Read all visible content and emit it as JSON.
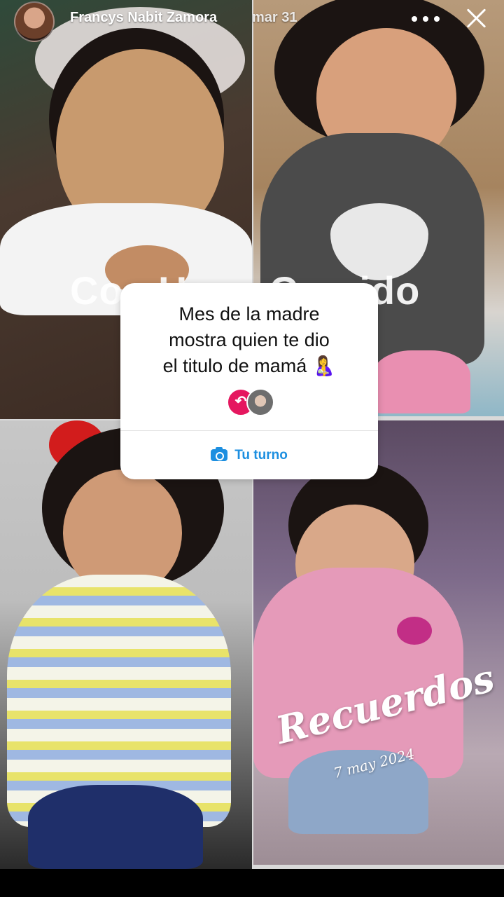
{
  "header": {
    "username": "Francys Nabit Zamora",
    "timestamp": "mar 31",
    "more_icon": "more-horizontal-icon",
    "close_icon": "close-icon"
  },
  "story": {
    "overlay_text": "Co...Uso...Crecido",
    "question_box": {
      "text": "Mes de la madre\nmostra quien te dio\nel titulo de mamá 🤱",
      "reply_icon": "reply-arrow-icon",
      "your_turn_label": "Tu turno",
      "camera_icon": "camera-icon"
    },
    "sticker_text": "Recuerdos",
    "date_text": "7 may 2024"
  }
}
